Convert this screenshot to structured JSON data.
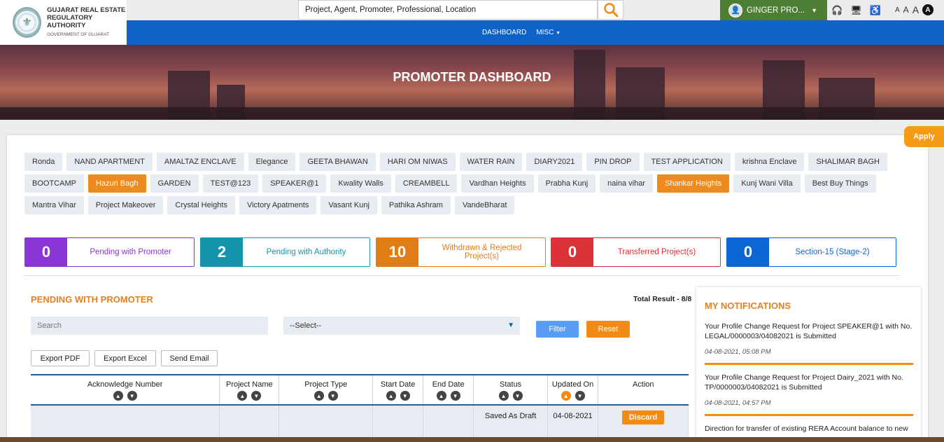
{
  "logo": {
    "line1": "GUJARAT REAL ESTATE",
    "line2": "REGULATORY AUTHORITY",
    "line3": "GOVERNMENT OF GUJARAT"
  },
  "search": {
    "placeholder": "Project, Agent, Promoter, Professional, Location"
  },
  "user": {
    "name": "GINGER PRO..."
  },
  "font_controls": {
    "small": "A",
    "medium": "A",
    "large": "A",
    "contrast": "A"
  },
  "nav": {
    "dashboard": "DASHBOARD",
    "misc": "MISC"
  },
  "hero": {
    "title": "PROMOTER DASHBOARD"
  },
  "apply": "Apply",
  "projects": [
    {
      "label": "Ronda",
      "selected": false
    },
    {
      "label": "NAND APARTMENT",
      "selected": false
    },
    {
      "label": "AMALTAZ ENCLAVE",
      "selected": false
    },
    {
      "label": "Elegance",
      "selected": false
    },
    {
      "label": "GEETA BHAWAN",
      "selected": false
    },
    {
      "label": "HARI OM NIWAS",
      "selected": false
    },
    {
      "label": "WATER RAIN",
      "selected": false
    },
    {
      "label": "DIARY2021",
      "selected": false
    },
    {
      "label": "PIN DROP",
      "selected": false
    },
    {
      "label": "TEST APPLICATION",
      "selected": false
    },
    {
      "label": "krishna Enclave",
      "selected": false
    },
    {
      "label": "SHALIMAR BAGH",
      "selected": false
    },
    {
      "label": "BOOTCAMP",
      "selected": false
    },
    {
      "label": "Hazuri Bagh",
      "selected": true
    },
    {
      "label": "GARDEN",
      "selected": false
    },
    {
      "label": "TEST@123",
      "selected": false
    },
    {
      "label": "SPEAKER@1",
      "selected": false
    },
    {
      "label": "Kwality Walls",
      "selected": false
    },
    {
      "label": "CREAMBELL",
      "selected": false
    },
    {
      "label": "Vardhan Heights",
      "selected": false
    },
    {
      "label": "Prabha Kunj",
      "selected": false
    },
    {
      "label": "naina vihar",
      "selected": false
    },
    {
      "label": "Shankar Heights",
      "selected": true
    },
    {
      "label": "Kunj Wani Villa",
      "selected": false
    },
    {
      "label": "Best Buy Things",
      "selected": false
    },
    {
      "label": "Mantra Vihar",
      "selected": false
    },
    {
      "label": "Project Makeover",
      "selected": false
    },
    {
      "label": "Crystal Heights",
      "selected": false
    },
    {
      "label": "Victory Apatments",
      "selected": false
    },
    {
      "label": "Vasant Kunj",
      "selected": false
    },
    {
      "label": "Pathika Ashram",
      "selected": false
    },
    {
      "label": "VandeBharat",
      "selected": false
    }
  ],
  "stats": [
    {
      "count": "0",
      "label": "Pending with Promoter",
      "color": "#8a35d6"
    },
    {
      "count": "2",
      "label": "Pending with Authority",
      "color": "#1595ad"
    },
    {
      "count": "10",
      "label": "Withdrawn & Rejected Project(s)",
      "color": "#e07d16"
    },
    {
      "count": "0",
      "label": "Transferred Project(s)",
      "color": "#db3237"
    },
    {
      "count": "0",
      "label": "Section-15 (Stage-2)",
      "color": "#0b66d4"
    }
  ],
  "list": {
    "title": "PENDING WITH PROMOTER",
    "total": "Total Result - 8/8",
    "search_placeholder": "Search",
    "select_value": "--Select--",
    "filter": "Filter",
    "reset": "Reset",
    "export_pdf": "Export PDF",
    "export_excel": "Export Excel",
    "send_email": "Send Email"
  },
  "table": {
    "columns": [
      "Acknowledge Number",
      "Project Name",
      "Project Type",
      "Start Date",
      "End Date",
      "Status",
      "Updated On",
      "Action"
    ],
    "rows": [
      {
        "ack": "",
        "name": "",
        "type": "",
        "start": "",
        "end": "",
        "status": "Saved As Draft",
        "updated": "04-08-2021",
        "action": "Discard"
      }
    ]
  },
  "notifications": {
    "title": "MY NOTIFICATIONS",
    "items": [
      {
        "text": "Your Profile Change Request for Project SPEAKER@1 with No. LEGAL/0000003/04082021 is Submitted",
        "time": "04-08-2021, 05:08 PM"
      },
      {
        "text": "Your Profile Change Request for Project Dairy_2021 with No. TP/0000003/04082021 is Submitted",
        "time": "04-08-2021, 04:57 PM"
      },
      {
        "text": "Direction for transfer of existing RERA Account balance to new",
        "time": ""
      }
    ]
  },
  "colors": {
    "accent": "#f28a16",
    "nav": "#0f63c8",
    "user": "#4c7f33"
  }
}
